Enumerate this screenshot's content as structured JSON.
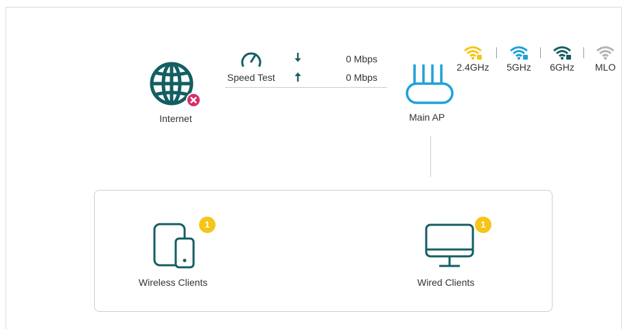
{
  "internet": {
    "label": "Internet",
    "status": "disconnected"
  },
  "speed_test": {
    "label": "Speed Test",
    "download": "0 Mbps",
    "upload": "0 Mbps"
  },
  "main_ap": {
    "label": "Main AP"
  },
  "bands": [
    {
      "label": "2.4GHz",
      "color": "#f5c518"
    },
    {
      "label": "5GHz",
      "color": "#1ea1d9"
    },
    {
      "label": "6GHz",
      "color": "#135e63"
    },
    {
      "label": "MLO",
      "color": "#b3b3b3"
    }
  ],
  "clients": {
    "wireless": {
      "label": "Wireless Clients",
      "count": "1"
    },
    "wired": {
      "label": "Wired Clients",
      "count": "1"
    }
  },
  "colors": {
    "icon_primary": "#135e63",
    "error": "#d62f6a",
    "badge": "#f5c518"
  }
}
